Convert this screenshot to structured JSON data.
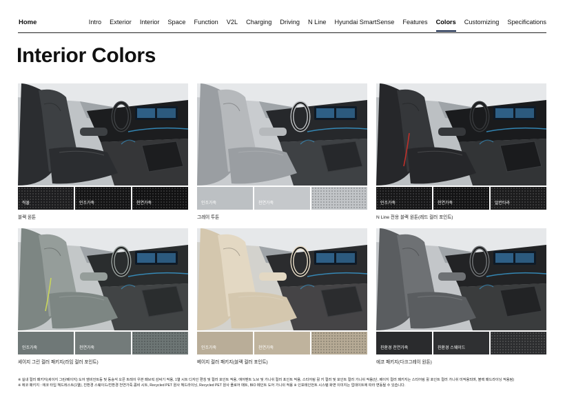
{
  "nav": {
    "home": "Home",
    "items": [
      "Intro",
      "Exterior",
      "Interior",
      "Space",
      "Function",
      "V2L",
      "Charging",
      "Driving",
      "N Line",
      "Hyundai SmartSense",
      "Features",
      "Colors",
      "Customizing",
      "Specifications"
    ],
    "active": "Colors"
  },
  "page": {
    "title": "Interior Colors"
  },
  "cards": [
    {
      "caption": "블랙 원톤",
      "theme": {
        "seat": "#2b2d30",
        "seat_light": "#3d4043",
        "dash": "#1c1d1f",
        "bg": "#bfc3c6",
        "accent": "#3aa0d8",
        "stitch": "none"
      },
      "swatches": [
        {
          "label": "직물",
          "color": "#1d1d1f",
          "texture": "dots-light"
        },
        {
          "label": "인조가죽",
          "color": "#141415",
          "texture": "dots-light"
        },
        {
          "label": "천연가죽",
          "color": "#111112",
          "texture": "dots-light"
        }
      ]
    },
    {
      "caption": "그레이 투톤",
      "theme": {
        "seat": "#9a9ea2",
        "seat_light": "#b6b9bc",
        "dash": "#26282b",
        "bg": "#c9cccf",
        "accent": "#3aa0d8",
        "stitch": "none"
      },
      "swatches": [
        {
          "label": "인조가죽",
          "color": "#bcc0c3",
          "texture": ""
        },
        {
          "label": "천연가죽",
          "color": "#c5c8cb",
          "texture": ""
        },
        {
          "label": "",
          "color": "#c2c5c8",
          "texture": "dots"
        }
      ]
    },
    {
      "caption": "N Line 전용 블랙 원톤(레드 컬러 포인트)",
      "theme": {
        "seat": "#26272a",
        "seat_light": "#35373a",
        "dash": "#1a1b1d",
        "bg": "#bcc0c3",
        "accent": "#3aa0d8",
        "stitch": "#c0302a"
      },
      "swatches": [
        {
          "label": "인조가죽",
          "color": "#161617",
          "texture": "dots-light"
        },
        {
          "label": "천연가죽",
          "color": "#131314",
          "texture": "dots-light"
        },
        {
          "label": "알칸타라",
          "color": "#1b1b1c",
          "texture": "dots-light"
        }
      ]
    },
    {
      "caption": "세이지 그린 컬러 패키지(라임 컬러 포인트)",
      "theme": {
        "seat": "#7d8683",
        "seat_light": "#959d9a",
        "dash": "#2a2d2e",
        "bg": "#c3c7c8",
        "accent": "#3aa0d8",
        "stitch": "#c9d65a"
      },
      "swatches": [
        {
          "label": "인조가죽",
          "color": "#6f7877",
          "texture": ""
        },
        {
          "label": "천연가죽",
          "color": "#737b7a",
          "texture": ""
        },
        {
          "label": "",
          "color": "#6d7675",
          "texture": "dots"
        }
      ]
    },
    {
      "caption": "베이지 컬러 패키지(블랙 컬러 포인트)",
      "theme": {
        "seat": "#d4c7ae",
        "seat_light": "#e3d8c3",
        "dash": "#2b2c2e",
        "bg": "#d3d2cd",
        "accent": "#3aa0d8",
        "stitch": "none"
      },
      "swatches": [
        {
          "label": "인조가죽",
          "color": "#b9ad98",
          "texture": ""
        },
        {
          "label": "천연가죽",
          "color": "#bfb39d",
          "texture": ""
        },
        {
          "label": "",
          "color": "#b6aa95",
          "texture": "dots"
        }
      ]
    },
    {
      "caption": "에코 패키지(다크그레이 원톤)",
      "theme": {
        "seat": "#5a5d60",
        "seat_light": "#6e7174",
        "dash": "#222325",
        "bg": "#c3c6c9",
        "accent": "#3aa0d8",
        "stitch": "none"
      },
      "swatches": [
        {
          "label": "친환경 천연가죽",
          "color": "#2a2b2d",
          "texture": ""
        },
        {
          "label": "친환경 스웨이드",
          "color": "#2f3032",
          "texture": ""
        },
        {
          "label": "",
          "color": "#2c2d2f",
          "texture": "dots-light"
        }
      ]
    }
  ],
  "notes": [
    "※ 실내 컬러 패키지(세이지 그린/베이지) 도어 앰비언트등 및 동승석 오픈 트레이 우븐 패브릭 감싸기 적용, 1열 시트 디자인 편칭 및 컬러 포인트 적용, 에어벤트 노브 및 가니쉬 컬러 포인트 적용, 스티어링 휠 키 컬러 및 포인트 컬러 가니쉬 적용(단, 베이지 컬러 패키지는 스티어링 휠 포인트 컬러 가니쉬 미적용되며, 블랙 패드라이닝 적용됨)",
    "※ 에코 패키지 : 에코 타입 헤드레스트(1열), 친환경 스웨이드/친환경 천연가죽 콤비 시트, Recycled PET 원사 헤드라이닝, Recycled PET 원사 플로어 매트, BIO 페인트 도어 가니쉬 적용  ※ 인포테인먼트 시스템 화면 이미지는 업데이트에 따라 변동될 수 있습니다."
  ]
}
